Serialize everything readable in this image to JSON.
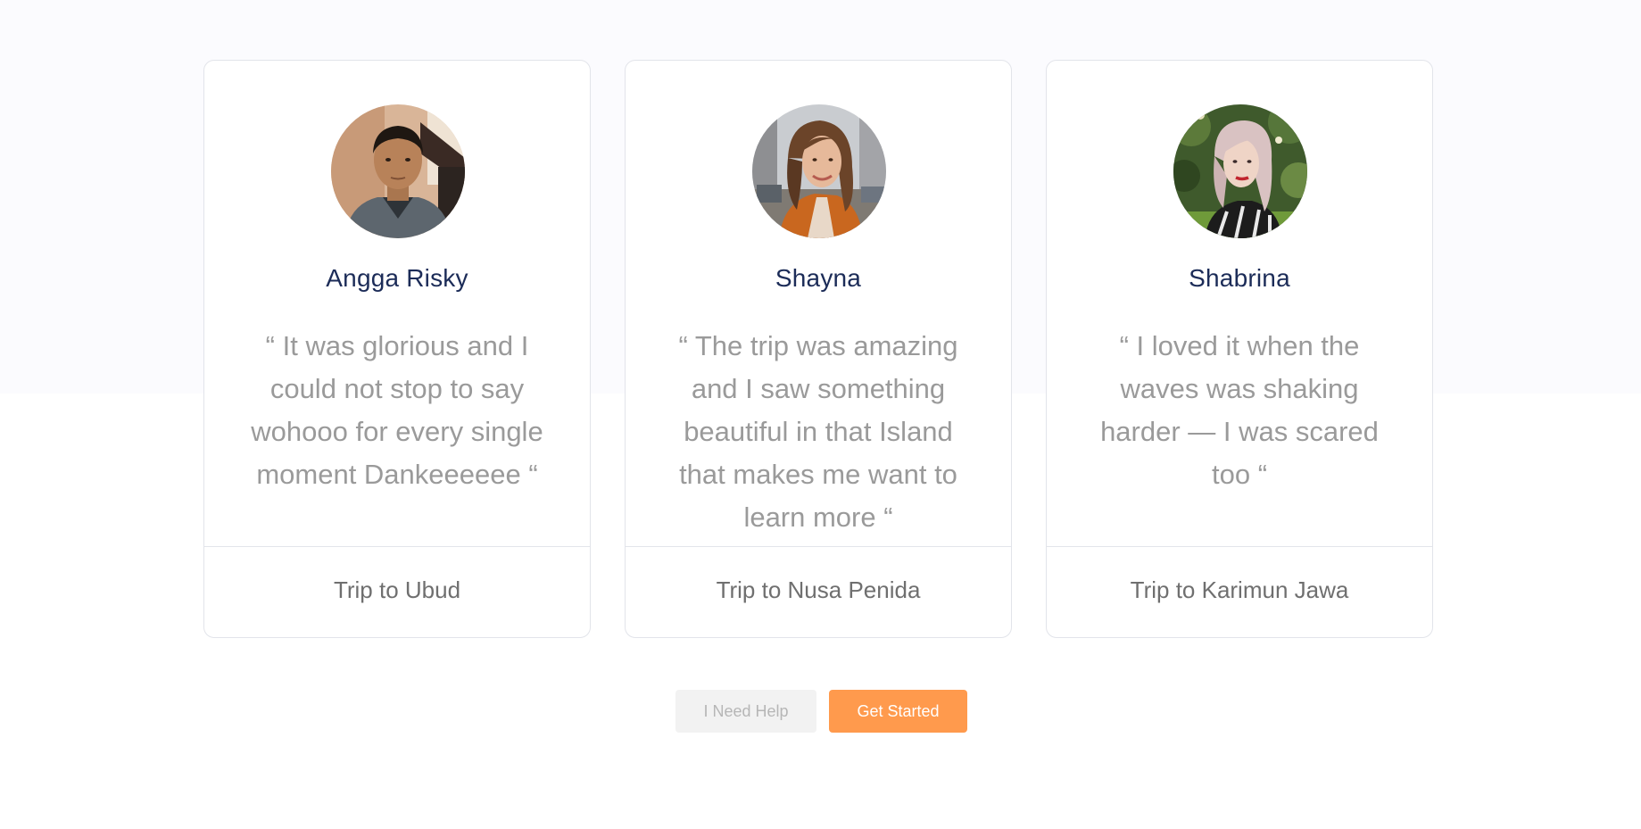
{
  "testimonials": [
    {
      "name": "Angga Risky",
      "quote": "“ It was glorious and I could not stop to say wohooo for every single moment Dankeeeeee “",
      "trip": "Trip to Ubud"
    },
    {
      "name": "Shayna",
      "quote": "“ The trip was amazing and I saw something beautiful in that Island that makes me want to learn more “",
      "trip": "Trip to Nusa Penida"
    },
    {
      "name": "Shabrina",
      "quote": "“ I loved it when the waves was shaking harder — I was scared too “",
      "trip": "Trip to Karimun Jawa"
    }
  ],
  "actions": {
    "help_label": "I Need Help",
    "start_label": "Get Started"
  },
  "colors": {
    "accent": "#ff9a4d",
    "name_text": "#1c2c58",
    "quote_text": "#9a9a9a",
    "band_background": "#fbfbfe"
  },
  "icons": [
    "avatar-photo-man",
    "avatar-photo-woman-street",
    "avatar-photo-woman-garden"
  ]
}
